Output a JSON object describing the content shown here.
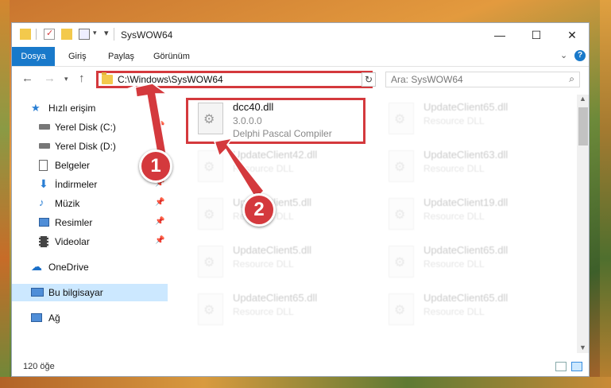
{
  "window": {
    "title": "SysWOW64"
  },
  "ribbon": {
    "tabs": [
      "Dosya",
      "Giriş",
      "Paylaş",
      "Görünüm"
    ]
  },
  "nav": {
    "address_path": "C:\\Windows\\SysWOW64",
    "search_placeholder": "Ara: SysWOW64"
  },
  "sidebar": {
    "items": [
      {
        "label": "Hızlı erişim",
        "icon": "star-icon"
      },
      {
        "label": "Yerel Disk (C:)",
        "icon": "drive-icon",
        "pinned": true
      },
      {
        "label": "Yerel Disk (D:)",
        "icon": "drive-icon",
        "pinned": true
      },
      {
        "label": "Belgeler",
        "icon": "documents-icon",
        "pinned": true
      },
      {
        "label": "İndirmeler",
        "icon": "download-icon",
        "pinned": true
      },
      {
        "label": "Müzik",
        "icon": "music-icon",
        "pinned": true
      },
      {
        "label": "Resimler",
        "icon": "pictures-icon",
        "pinned": true
      },
      {
        "label": "Videolar",
        "icon": "videos-icon",
        "pinned": true
      },
      {
        "label": "OneDrive",
        "icon": "cloud-icon"
      },
      {
        "label": "Bu bilgisayar",
        "icon": "computer-icon",
        "selected": true
      },
      {
        "label": "Ağ",
        "icon": "network-icon"
      }
    ]
  },
  "files": {
    "highlighted": {
      "name": "dcc40.dll",
      "version": "3.0.0.0",
      "description": "Delphi Pascal Compiler"
    },
    "left_column": [
      {
        "name": "UpdateClient42.dll",
        "description": "Resource DLL"
      },
      {
        "name": "UpdateClient5.dll",
        "description": "Resource DLL"
      },
      {
        "name": "UpdateClient5.dll",
        "description": "Resource DLL"
      },
      {
        "name": "UpdateClient65.dll",
        "description": "Resource DLL"
      }
    ],
    "right_column": [
      {
        "name": "UpdateClient65.dll",
        "description": "Resource DLL"
      },
      {
        "name": "UpdateClient63.dll",
        "description": "Resource DLL"
      },
      {
        "name": "UpdateClient19.dll",
        "description": "Resource DLL"
      },
      {
        "name": "UpdateClient65.dll",
        "description": "Resource DLL"
      },
      {
        "name": "UpdateClient65.dll",
        "description": "Resource DLL"
      }
    ]
  },
  "status": {
    "item_count": "120 öğe"
  },
  "annotations": {
    "badge1": "1",
    "badge2": "2",
    "color": "#d4393d"
  }
}
